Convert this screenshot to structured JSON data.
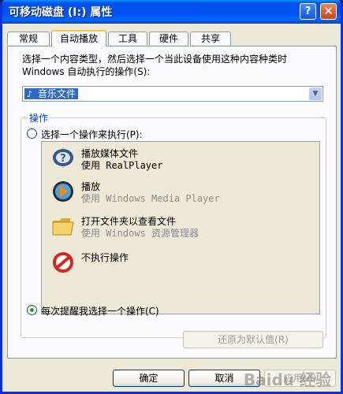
{
  "window": {
    "title": "可移动磁盘 (I:) 属性"
  },
  "tabs": [
    {
      "label": "常规"
    },
    {
      "label": "自动播放",
      "active": true
    },
    {
      "label": "工具"
    },
    {
      "label": "硬件"
    },
    {
      "label": "共享"
    }
  ],
  "desc": {
    "line1": "选择一个内容类型，然后选择一个当此设备使用这种内容种类时",
    "line2": "Windows 自动执行的操作(S):"
  },
  "content_type": {
    "selected": "音乐文件",
    "icon": "music-note-icon"
  },
  "group": {
    "label": "操作"
  },
  "radio_choose": {
    "label": "选择一个操作来执行(P):",
    "checked": false
  },
  "actions": [
    {
      "title": "播放媒体文件",
      "subtitle": "使用 RealPlayer",
      "icon": "realplayer-icon",
      "enabled": true
    },
    {
      "title": "播放",
      "subtitle": "使用 Windows Media Player",
      "icon": "media-player-icon",
      "enabled": false
    },
    {
      "title": "打开文件夹以查看文件",
      "subtitle": "使用 Windows 资源管理器",
      "icon": "folder-icon",
      "enabled": false
    },
    {
      "title": "不执行操作",
      "subtitle": "",
      "icon": "no-action-icon",
      "enabled": true
    }
  ],
  "radio_prompt": {
    "label": "每次提醒我选择一个操作(C)",
    "checked": true
  },
  "buttons": {
    "restore": "还原为默认值(R)",
    "ok": "确定",
    "cancel": "取消",
    "apply": "应用(A)"
  },
  "watermark": "Baidu 经验",
  "colors": {
    "title_bar": "#0054e3",
    "window_bg": "#ece9d8",
    "selection": "#316ac5",
    "group_label": "#0046d5"
  }
}
